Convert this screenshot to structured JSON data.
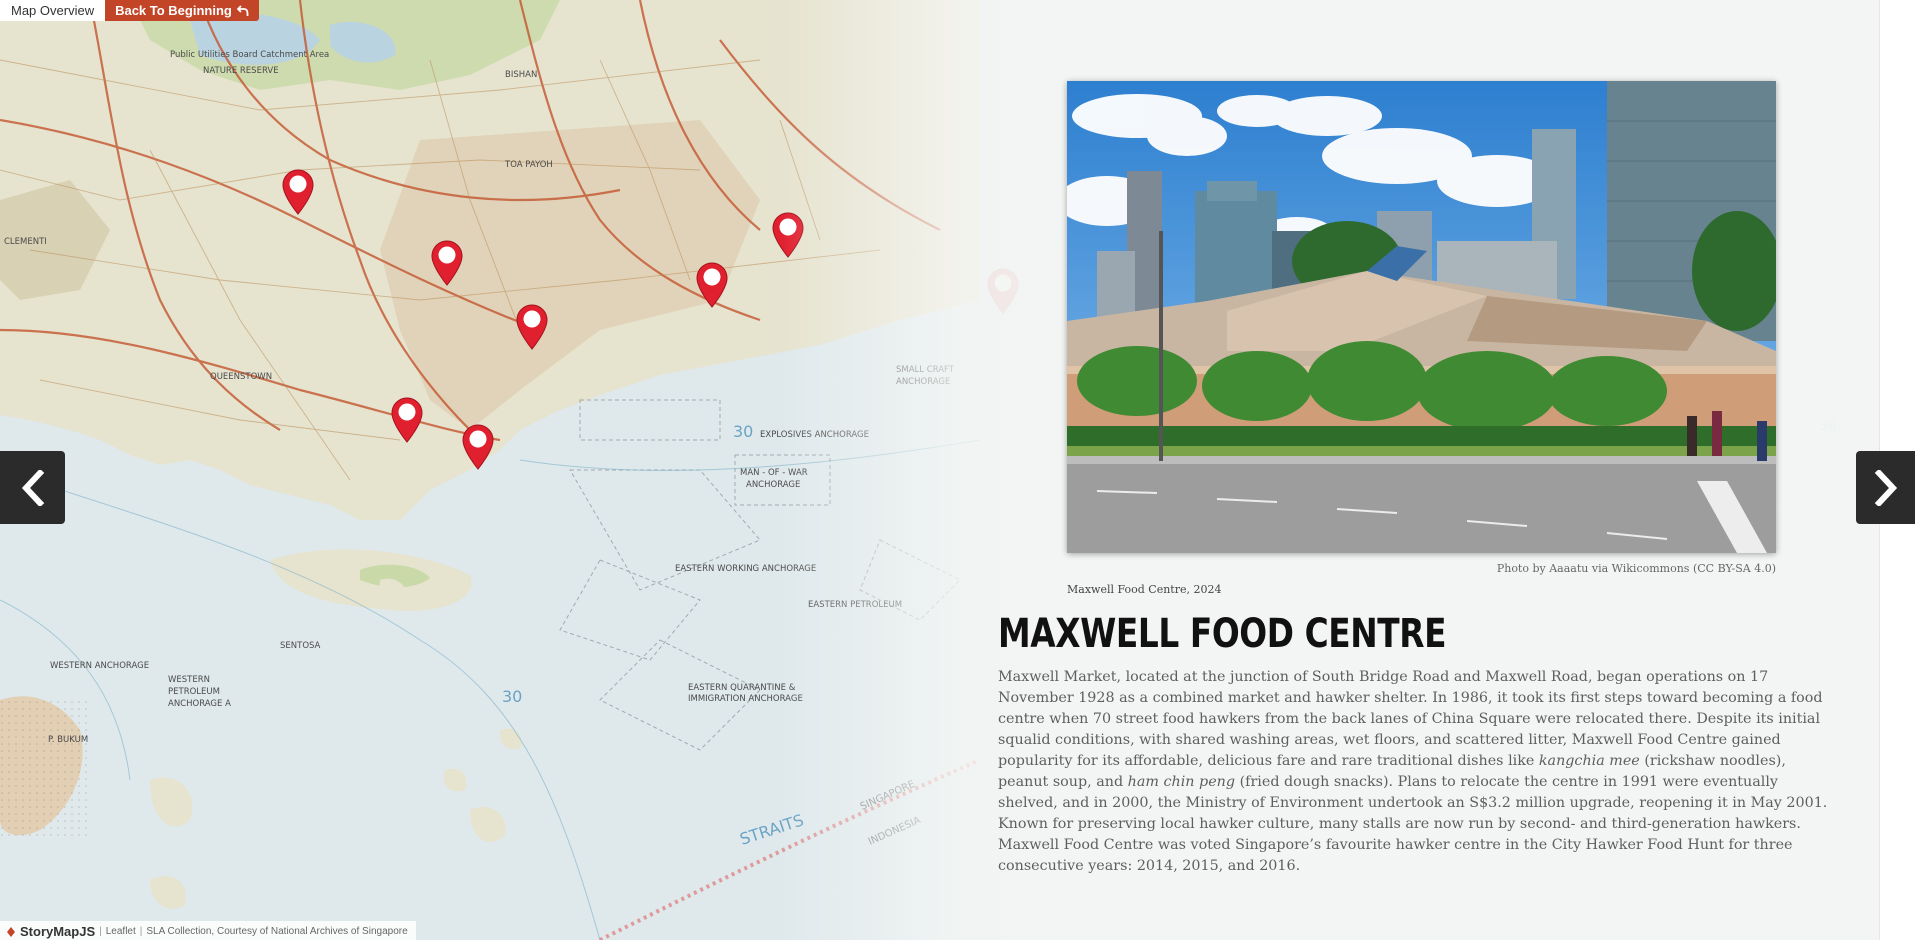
{
  "topbar": {
    "overview_label": "Map Overview",
    "back_label": "Back To Beginning"
  },
  "map": {
    "labels": [
      "Public Utilities Board Catchment Area",
      "NATURE RESERVE",
      "BISHAN",
      "TOA PAYOH",
      "QUEENSTOWN",
      "CLEMENTI",
      "SENTOSA",
      "EXPLOSIVES ANCHORAGE",
      "MAN-OF-WAR ANCHORAGE",
      "EASTERN WORKING ANCHORAGE",
      "EASTERN PETROLEUM ANCHORAGE",
      "EASTERN QUARANTINE & IMMIGRATION ANCHORAGE",
      "WESTERN PETROLEUM ANCHORAGE A",
      "WESTERN ANCHORAGE",
      "P. BUKUM",
      "SMALL CRAFT ANCHORAGE",
      "STRAITS",
      "SINGAPORE",
      "INDONESIA",
      "30"
    ],
    "marker_count": 8
  },
  "slide": {
    "photo_alt": "Maxwell Food Centre, 2024",
    "credit": "Photo by Aaaatu via Wikicommons (CC BY-SA 4.0)",
    "caption": "Maxwell Food Centre, 2024",
    "headline": "MAXWELL FOOD CENTRE",
    "body": {
      "p1": "Maxwell Market, located at the junction of South Bridge Road and Maxwell Road, began operations on 17 November 1928 as a combined market and hawker shelter. In 1986, it took its first steps toward becoming a food centre when 70 street food hawkers from the back lanes of China Square were relocated there. Despite its initial squalid conditions, with shared washing areas, wet floors, and scattered litter, Maxwell Food Centre gained popularity for its affordable, delicious fare and rare traditional dishes like ",
      "em1": "kangchia mee",
      "p2": " (rickshaw noodles), peanut soup, and ",
      "em2": "ham chin peng",
      "p3": " (fried dough snacks). Plans to relocate the centre in 1991 were eventually shelved, and in 2000, the Ministry of Environment undertook an S$3.2 million upgrade, reopening it in May 2001. Known for preserving local hawker culture, many stalls are now run by second- and third-generation hawkers. Maxwell Food Centre was voted Singapore’s favourite hawker centre in the City Hawker Food Hunt for three consecutive years: 2014, 2015, and 2016."
    }
  },
  "attribution": {
    "brand": "StoryMapJS",
    "leaflet": "Leaflet",
    "source": "SLA Collection, Courtesy of National Archives of Singapore"
  },
  "colors": {
    "accent": "#c34528",
    "marker": "#e0202f",
    "nav": "#2b2b2b"
  },
  "icons": {
    "back": "undo-arrow-icon",
    "prev": "chevron-left-icon",
    "next": "chevron-right-icon",
    "marker": "map-pin-icon",
    "brand": "storymap-logo-icon"
  }
}
